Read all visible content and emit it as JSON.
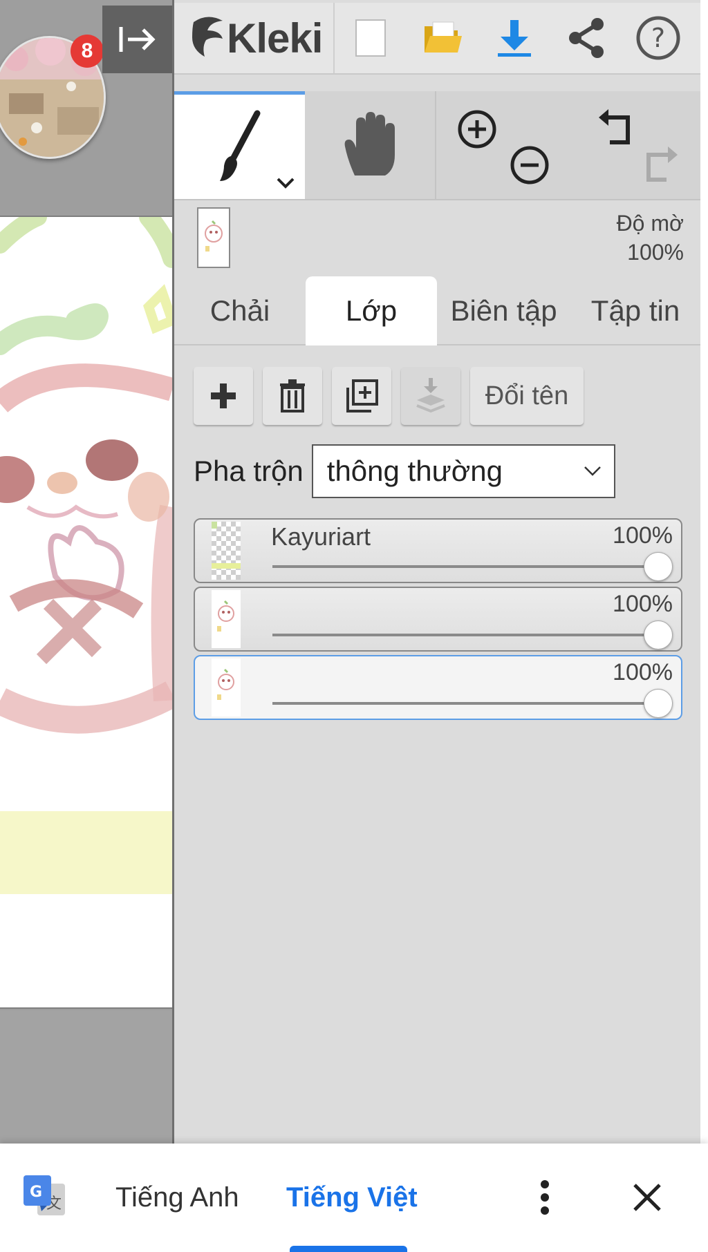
{
  "chat_head": {
    "badge_count": "8"
  },
  "app": {
    "logo_text": "Kleki"
  },
  "toolbar_icons": [
    "new-file-icon",
    "open-folder-icon",
    "download-icon",
    "share-icon",
    "help-icon"
  ],
  "tools": [
    "brush",
    "hand",
    "zoom",
    "undo-redo"
  ],
  "opacity": {
    "label": "Độ mờ",
    "value": "100%"
  },
  "tabs": [
    {
      "label": "Chải",
      "active": false
    },
    {
      "label": "Lớp",
      "active": true
    },
    {
      "label": "Biên tập",
      "active": false
    },
    {
      "label": "Tập tin",
      "active": false
    }
  ],
  "layer_actions": {
    "rename_label": "Đổi tên"
  },
  "blend": {
    "label": "Pha trộn",
    "value": "thông thường"
  },
  "layers": [
    {
      "name": "Kayuriart",
      "opacity_label": "100%",
      "opacity": 1.0,
      "selected": false
    },
    {
      "name": "",
      "opacity_label": "100%",
      "opacity": 1.0,
      "selected": false
    },
    {
      "name": "",
      "opacity_label": "100%",
      "opacity": 1.0,
      "selected": true
    }
  ],
  "translate_bar": {
    "source_lang": "Tiếng Anh",
    "target_lang": "Tiếng Việt",
    "accent_color": "#1a73e8"
  }
}
